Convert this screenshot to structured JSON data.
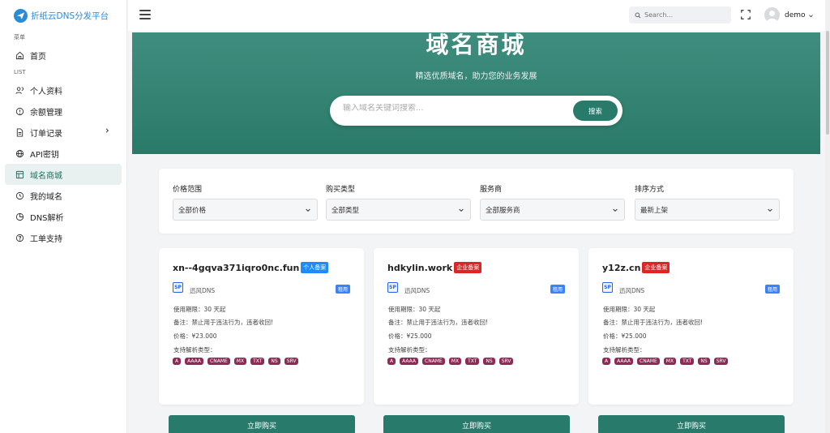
{
  "brand": {
    "name": "折纸云DNS分发平台"
  },
  "sidebar": {
    "caption_menu": "菜单",
    "caption_list": "LIST",
    "home": "首页",
    "items": [
      {
        "label": "个人资料",
        "icon": "users-icon"
      },
      {
        "label": "余额管理",
        "icon": "alert-circle-icon"
      },
      {
        "label": "订单记录",
        "icon": "file-icon"
      },
      {
        "label": "API密钥",
        "icon": "globe-icon"
      },
      {
        "label": "域名商城",
        "icon": "layout-icon",
        "active": true
      },
      {
        "label": "我的域名",
        "icon": "clock-icon"
      },
      {
        "label": "DNS解析",
        "icon": "pie-icon"
      },
      {
        "label": "工单支持",
        "icon": "help-circle-icon"
      }
    ]
  },
  "topbar": {
    "search_placeholder": "Search...",
    "user": "demo"
  },
  "hero": {
    "title": "域名商城",
    "subtitle": "精选优质域名，助力您的业务发展",
    "search_placeholder": "输入域名关键词搜索...",
    "search_button": "搜索"
  },
  "filters": [
    {
      "label": "价格范围",
      "value": "全部价格"
    },
    {
      "label": "购买类型",
      "value": "全部类型"
    },
    {
      "label": "服务商",
      "value": "全部服务商"
    },
    {
      "label": "排序方式",
      "value": "最新上架"
    }
  ],
  "cards": [
    {
      "domain": "xn--4gqva371iqro0nc.fun",
      "badge": "个人备案",
      "badge_color": "#1d8cf8",
      "sp": "SP",
      "provider": "迅风DNS",
      "tag": "租用",
      "period": "使用期限：30 天起",
      "note": "备注：禁止用于违法行为，违者收回!",
      "price": "价格：¥23.000",
      "records_label": "支持解析类型：",
      "records": [
        "A",
        "AAAA",
        "CNAME",
        "MX",
        "TXT",
        "NS",
        "SRV"
      ],
      "buy": "立即购买"
    },
    {
      "domain": "hdkylin.work",
      "badge": "企业备案",
      "badge_color": "#e02424",
      "sp": "SP",
      "provider": "迅风DNS",
      "tag": "租用",
      "period": "使用期限：30 天起",
      "note": "备注：禁止用于违法行为，违者收回!",
      "price": "价格：¥25.000",
      "records_label": "支持解析类型：",
      "records": [
        "A",
        "AAAA",
        "CNAME",
        "MX",
        "TXT",
        "NS",
        "SRV"
      ],
      "buy": "立即购买"
    },
    {
      "domain": "y12z.cn",
      "badge": "企业备案",
      "badge_color": "#e02424",
      "sp": "SP",
      "provider": "迅风DNS",
      "tag": "租用",
      "period": "使用期限：30 天起",
      "note": "备注：禁止用于违法行为，违者收回!",
      "price": "价格：¥25.000",
      "records_label": "支持解析类型：",
      "records": [
        "A",
        "AAAA",
        "CNAME",
        "MX",
        "TXT",
        "NS",
        "SRV"
      ],
      "buy": "立即购买"
    }
  ]
}
